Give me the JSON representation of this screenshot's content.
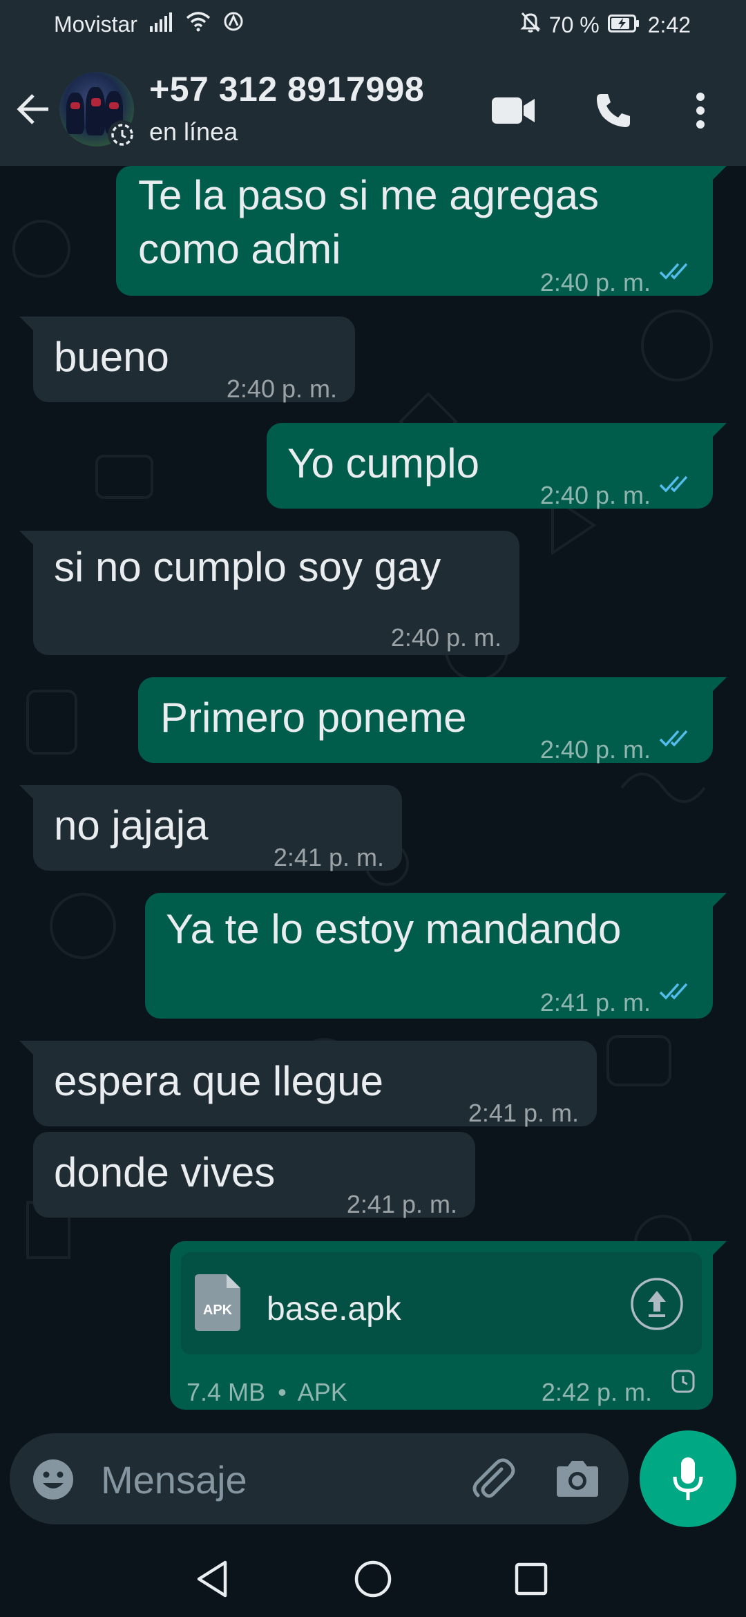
{
  "status_bar": {
    "carrier": "Movistar",
    "battery": "70 %",
    "time": "2:42"
  },
  "header": {
    "contact_name": "+57 312 8917998",
    "contact_status": "en línea"
  },
  "messages": [
    {
      "dir": "out",
      "text_lines": [
        "Te la paso si me agregas",
        "como admi"
      ],
      "time": "2:40 p. m.",
      "read": true
    },
    {
      "dir": "in",
      "text": "bueno",
      "time": "2:40 p. m."
    },
    {
      "dir": "out",
      "text": "Yo cumplo",
      "time": "2:40 p. m.",
      "read": true
    },
    {
      "dir": "in",
      "text": "si no cumplo soy gay",
      "time": "2:40 p. m."
    },
    {
      "dir": "out",
      "text": "Primero poneme",
      "time": "2:40 p. m.",
      "read": true
    },
    {
      "dir": "in",
      "text": "no jajaja",
      "time": "2:41 p. m."
    },
    {
      "dir": "out",
      "text": "Ya te lo estoy mandando",
      "time": "2:41 p. m.",
      "read": true
    },
    {
      "dir": "in",
      "text": "espera que llegue",
      "time": "2:41 p. m."
    },
    {
      "dir": "in",
      "text": "donde vives",
      "time": "2:41 p. m."
    }
  ],
  "file_message": {
    "icon_label": "APK",
    "file_name": "base.apk",
    "size": "7.4 MB",
    "separator": "•",
    "type": "APK",
    "time": "2:42 p. m.",
    "status": "pending-clock-icon"
  },
  "input": {
    "placeholder": "Mensaje"
  },
  "colors": {
    "header_bg": "#1f2c34",
    "chat_bg": "#0b141a",
    "outgoing_bubble": "#005c4b",
    "incoming_bubble": "#202c33",
    "accent": "#00a884",
    "read_ticks": "#53bdeb"
  }
}
